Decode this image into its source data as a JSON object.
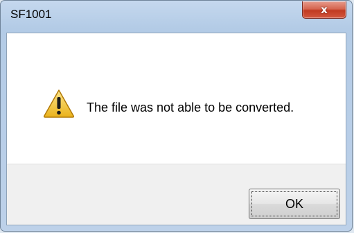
{
  "window": {
    "title": "SF1001",
    "close_glyph": "x"
  },
  "message": {
    "icon": "warning-icon",
    "text": "The file was not able to be converted."
  },
  "buttons": {
    "ok_label": "OK"
  },
  "colors": {
    "close_button": "#c13a22",
    "warning_fill": "#f5c624"
  }
}
